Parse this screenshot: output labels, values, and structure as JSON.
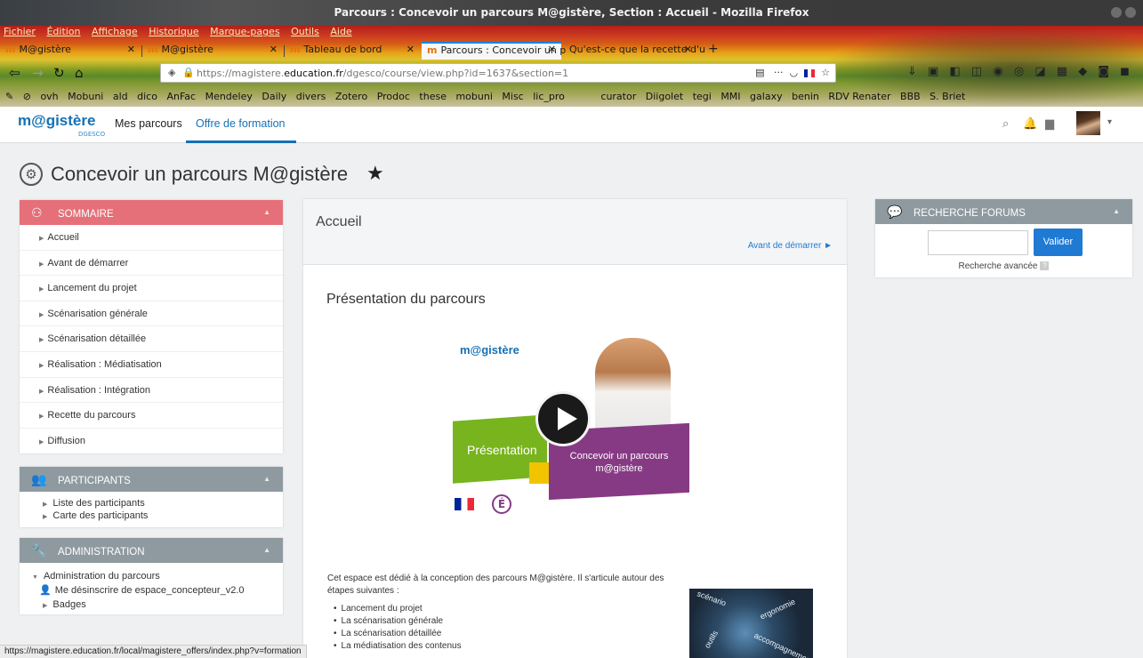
{
  "window": {
    "title": "Parcours : Concevoir un parcours M@gistère, Section : Accueil - Mozilla Firefox"
  },
  "menu": [
    "Fichier",
    "Édition",
    "Affichage",
    "Historique",
    "Marque-pages",
    "Outils",
    "Aide"
  ],
  "tabs": [
    {
      "label": "M@gistère",
      "icon": "m-favicon"
    },
    {
      "label": "M@gistère",
      "icon": "m-favicon"
    },
    {
      "label": "Tableau de bord",
      "icon": "m-favicon"
    },
    {
      "label": "Parcours : Concevoir un p",
      "icon": "m-favicon",
      "active": true
    },
    {
      "label": "Qu'est-ce que la recette d'u",
      "icon": "none"
    }
  ],
  "urlbar": {
    "prefix": "https://magistere.",
    "domain": "education.fr",
    "path": "/dgesco/course/view.php?id=1637&section=1"
  },
  "bookmarks": [
    "ovh",
    "Mobuni",
    "ald",
    "dico",
    "AnFac",
    "Mendeley",
    "Daily",
    "divers",
    "Zotero",
    "Prodoc",
    "these",
    "mobuni",
    "Misc",
    "lic_pro",
    "curator",
    "Diigolet",
    "tegi",
    "MMI",
    "galaxy",
    "benin",
    "RDV Renater",
    "BBB",
    "S. Briet"
  ],
  "site": {
    "logo": "m@gistère",
    "logo_sub": "DGESCO",
    "nav": {
      "mes_parcours": "Mes parcours",
      "offre": "Offre de formation"
    }
  },
  "page": {
    "title": "Concevoir un parcours M@gistère"
  },
  "sommaire": {
    "header": "SOMMAIRE",
    "items": [
      "Accueil",
      "Avant de démarrer",
      "Lancement du projet",
      "Scénarisation générale",
      "Scénarisation détaillée",
      "Réalisation : Médiatisation",
      "Réalisation : Intégration",
      "Recette du parcours",
      "Diffusion"
    ]
  },
  "participants": {
    "header": "PARTICIPANTS",
    "items": [
      "Liste des participants",
      "Carte des participants"
    ]
  },
  "administration": {
    "header": "ADMINISTRATION",
    "items": [
      "Administration du parcours",
      "Me désinscrire de espace_concepteur_v2.0",
      "Badges"
    ]
  },
  "recherche": {
    "header": "RECHERCHE FORUMS",
    "button": "Valider",
    "advanced": "Recherche avancée",
    "help": "?"
  },
  "main": {
    "section_title": "Accueil",
    "avant_link": "Avant de démarrer ►",
    "presentation_title": "Présentation du parcours",
    "video": {
      "logo": "m@gistère",
      "label": "Présentation",
      "caption_line1": "Concevoir un parcours",
      "caption_line2": "m@gistère",
      "e_logo": "É"
    },
    "intro": "Cet espace est dédié à la conception des parcours M@gistère. Il s'articule autour des étapes suivantes :",
    "steps": [
      "Lancement du projet",
      "La scénarisation générale",
      "La scénarisation détaillée",
      "La médiatisation des contenus"
    ],
    "word_image": [
      "scénario",
      "ergonomie",
      "outils",
      "accompagnement"
    ]
  },
  "statusbar": {
    "url": "https://magistere.education.fr/local/magistere_offers/index.php?v=formation"
  }
}
